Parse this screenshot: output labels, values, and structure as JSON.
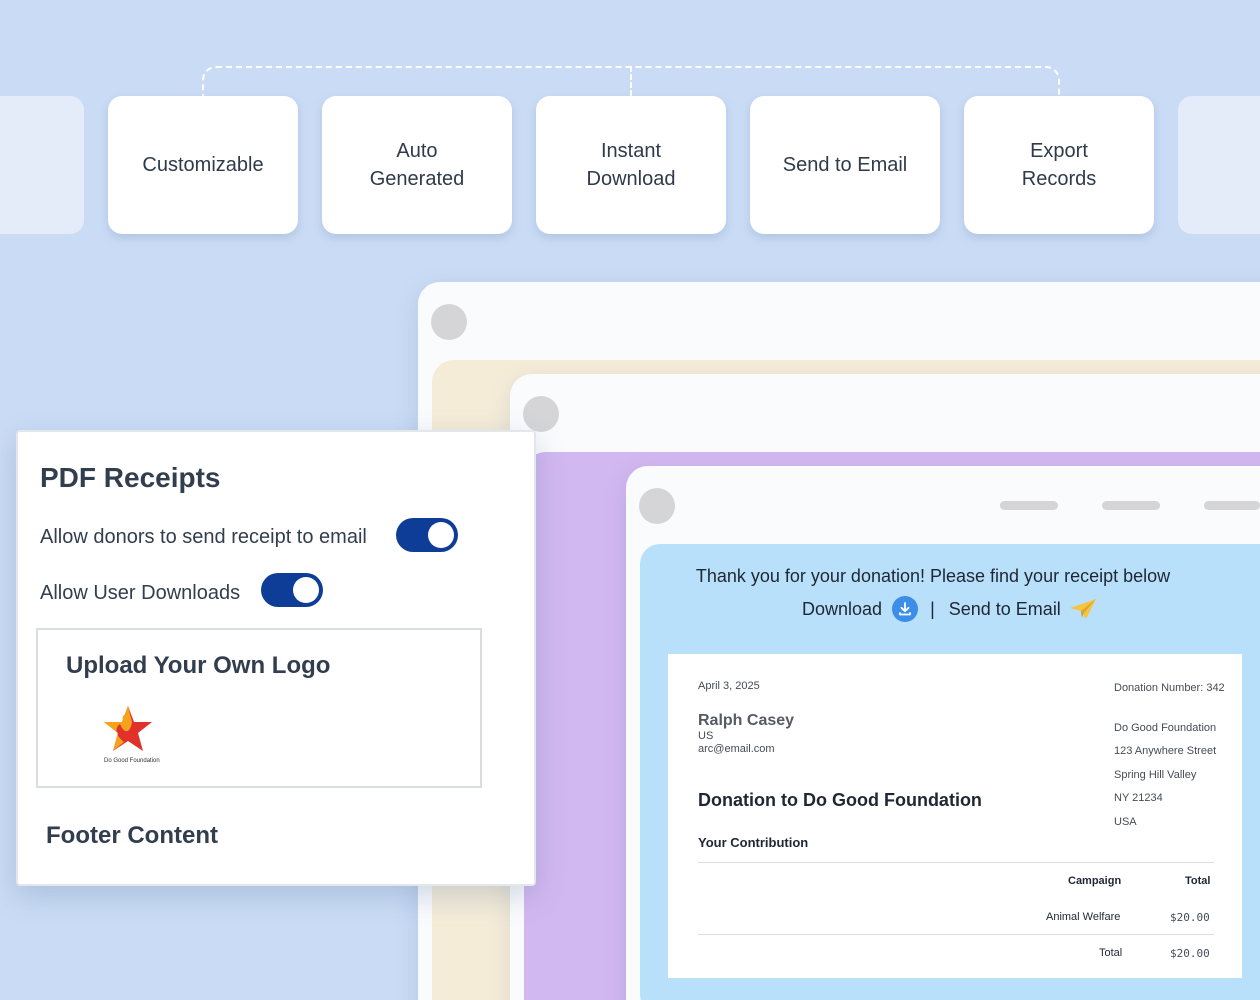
{
  "features": [
    {
      "line1": "Customizable",
      "line2": ""
    },
    {
      "line1": "Auto",
      "line2": "Generated"
    },
    {
      "line1": "Instant",
      "line2": "Download"
    },
    {
      "line1": "Send to Email",
      "line2": ""
    },
    {
      "line1": "Export",
      "line2": "Records"
    }
  ],
  "settings": {
    "title": "PDF Receipts",
    "toggle_email_label": "Allow donors to send receipt to email",
    "toggle_download_label": "Allow User Downloads",
    "upload_logo_title": "Upload Your Own Logo",
    "logo_caption": "Do Good Foundation",
    "footer_title": "Footer Content"
  },
  "receipt_page": {
    "thanks_message": "Thank you for your donation! Please find your receipt below",
    "download_label": "Download",
    "separator": "|",
    "send_email_label": "Send to Email"
  },
  "receipt": {
    "date": "April 3, 2025",
    "donation_number": "Donation Number: 342",
    "donor_name": "Ralph Casey",
    "donor_country": "US",
    "donor_email": "arc@email.com",
    "org_lines": [
      "Do Good Foundation",
      "123 Anywhere Street",
      "Spring Hill Valley",
      "NY 21234",
      "USA"
    ],
    "heading": "Donation to Do Good Foundation",
    "contribution_label": "Your Contribution",
    "col_campaign": "Campaign",
    "col_total": "Total",
    "row_campaign": "Animal Welfare",
    "row_amount": "$20.00",
    "total_label": "Total",
    "total_amount": "$20.00"
  },
  "colors": {
    "background": "#cadcf5",
    "toggle_on": "#0e3d98",
    "receipt_area": "#b9e0fa",
    "window_purple": "#d2b8f0",
    "window_cream": "#f5ecd8"
  }
}
